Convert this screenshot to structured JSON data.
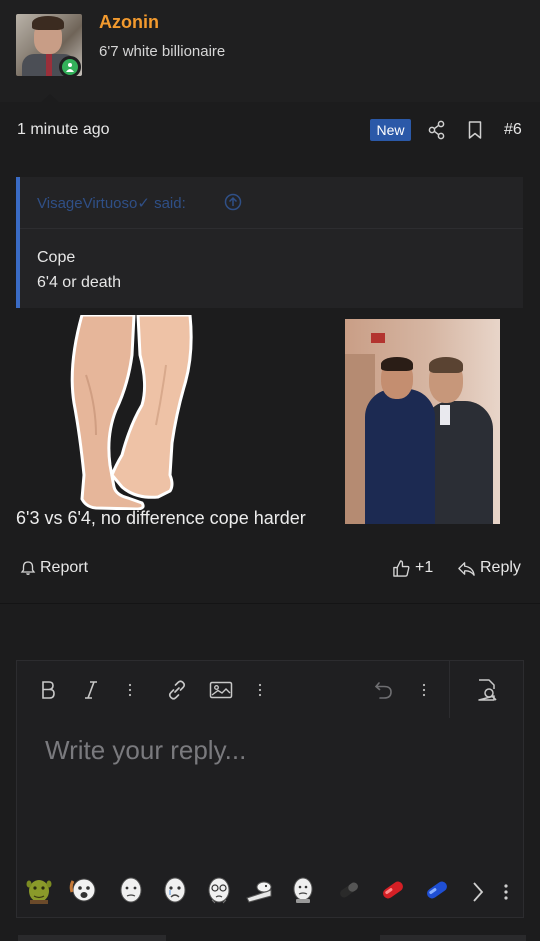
{
  "user": {
    "name": "Azonin",
    "title": "6'7 white billionaire"
  },
  "post": {
    "time": "1 minute ago",
    "badge": "New",
    "number": "#6",
    "quote": {
      "author": "VisageVirtuoso✓ said:",
      "lines": [
        "Cope",
        "6'4 or death"
      ]
    },
    "caption": "6'3 vs 6'4, no difference cope harder",
    "actions": {
      "report": "Report",
      "like_count": "+1",
      "reply": "Reply"
    }
  },
  "editor": {
    "placeholder": "Write your reply...",
    "toolbar": [
      "bold-icon",
      "italic-icon",
      "more-options-icon",
      "link-icon",
      "image-icon",
      "more-options-icon",
      "undo-icon",
      "more-options-icon",
      "preview-icon"
    ],
    "smilies": [
      "shrek-smilie",
      "soyjak-smilie",
      "wojak-smilie",
      "crying-wojak-smilie",
      "glasses-wojak-smilie",
      "lying-smilie",
      "coping-smilie",
      "black-pill",
      "red-pill",
      "blue-pill"
    ]
  },
  "colors": {
    "background": "#1c1c1d",
    "username": "#f29a2e",
    "badge": "#2b59a8",
    "quote_border": "#3a6bc4",
    "online": "#33b05a"
  }
}
